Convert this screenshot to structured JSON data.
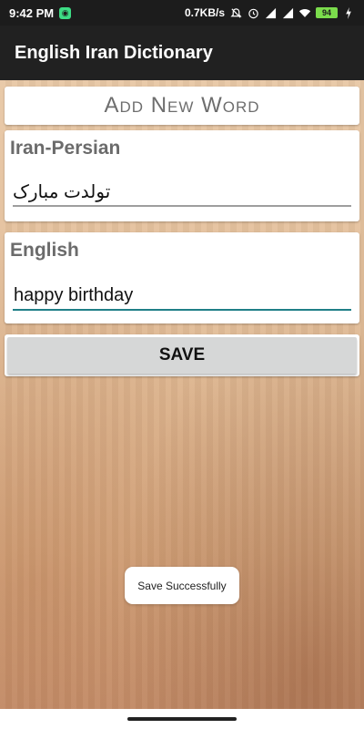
{
  "status_bar": {
    "time": "9:42 PM",
    "network_speed": "0.7KB/s",
    "battery": "94",
    "icons": [
      "app-notification-icon",
      "mute-icon",
      "alarm-icon",
      "signal-icon",
      "signal-icon",
      "wifi-icon",
      "battery-icon",
      "charging-icon"
    ]
  },
  "app_bar": {
    "title": "English Iran Dictionary"
  },
  "form": {
    "heading": "Add New Word",
    "persian_label": "Iran-Persian",
    "persian_value": "تولدت مبارک",
    "english_label": "English",
    "english_value": "happy birthday",
    "save_label": "SAVE"
  },
  "toast": {
    "message": "Save Successfully"
  },
  "colors": {
    "app_bar": "#212121",
    "status_bar": "#1c1c1c",
    "accent_underline": "#1f7f87",
    "button": "#d6d7d7",
    "battery": "#7bdc4c"
  }
}
